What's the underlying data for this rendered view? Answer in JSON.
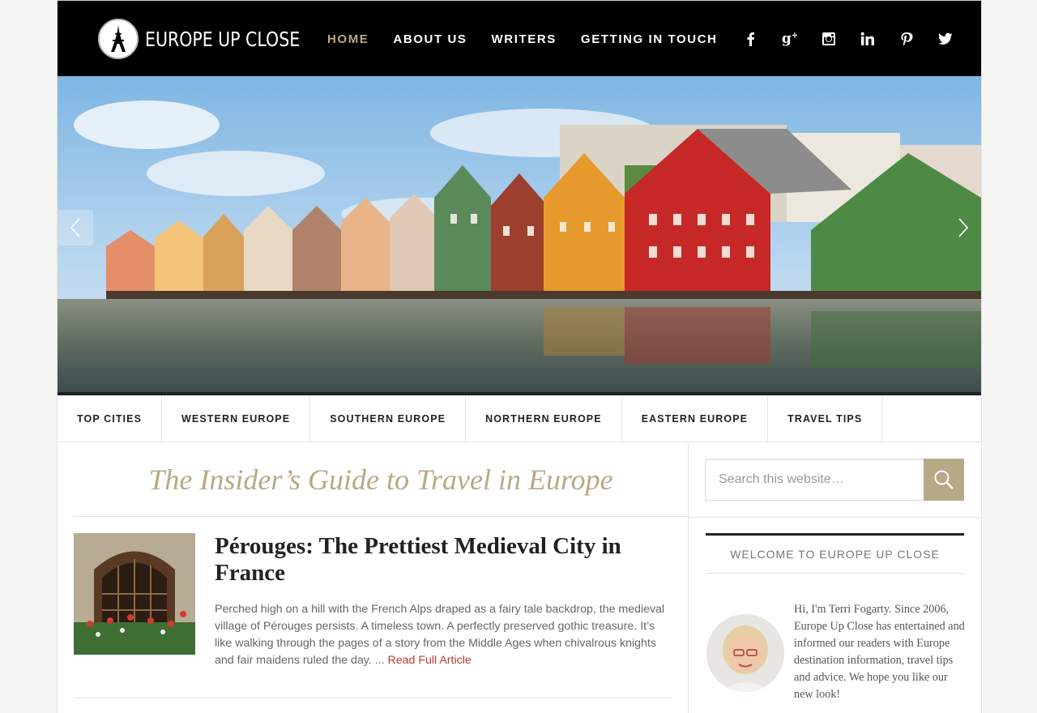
{
  "site": {
    "logo_text": "EUROPE UP CLOSE"
  },
  "main_nav": [
    {
      "label": "HOME",
      "active": true
    },
    {
      "label": "ABOUT US",
      "active": false
    },
    {
      "label": "WRITERS",
      "active": false
    },
    {
      "label": "GETTING IN TOUCH",
      "active": false
    }
  ],
  "social_icons": [
    "facebook-icon",
    "google-plus-icon",
    "instagram-icon",
    "linkedin-icon",
    "pinterest-icon",
    "twitter-icon"
  ],
  "category_nav": [
    "TOP CITIES",
    "WESTERN EUROPE",
    "SOUTHERN EUROPE",
    "NORTHERN EUROPE",
    "EASTERN EUROPE",
    "TRAVEL TIPS"
  ],
  "tagline": "The Insider’s Guide to Travel in Europe",
  "post": {
    "title": "Pérouges: The Prettiest Medieval City in France",
    "excerpt": "Perched high on a hill with the French Alps draped as a fairy tale backdrop, the medieval village of Pérouges persists. A timeless town. A perfectly preserved gothic treasure. It’s like walking through the pages of a story from the Middle Ages when chivalrous knights and fair maidens ruled the day. ... ",
    "read_more": "Read Full Article"
  },
  "sidebar": {
    "search_placeholder": "Search this website…",
    "widget_title": "WELCOME TO EUROPE UP CLOSE",
    "welcome_text": "Hi, I'm Terri Fogarty. Since 2006, Europe Up Close has entertained and informed our readers with Europe destination information, travel tips and advice. We hope you like our new look!"
  },
  "colors": {
    "accent": "#b8a986",
    "header_bg": "#000000",
    "link": "#c0392b"
  }
}
